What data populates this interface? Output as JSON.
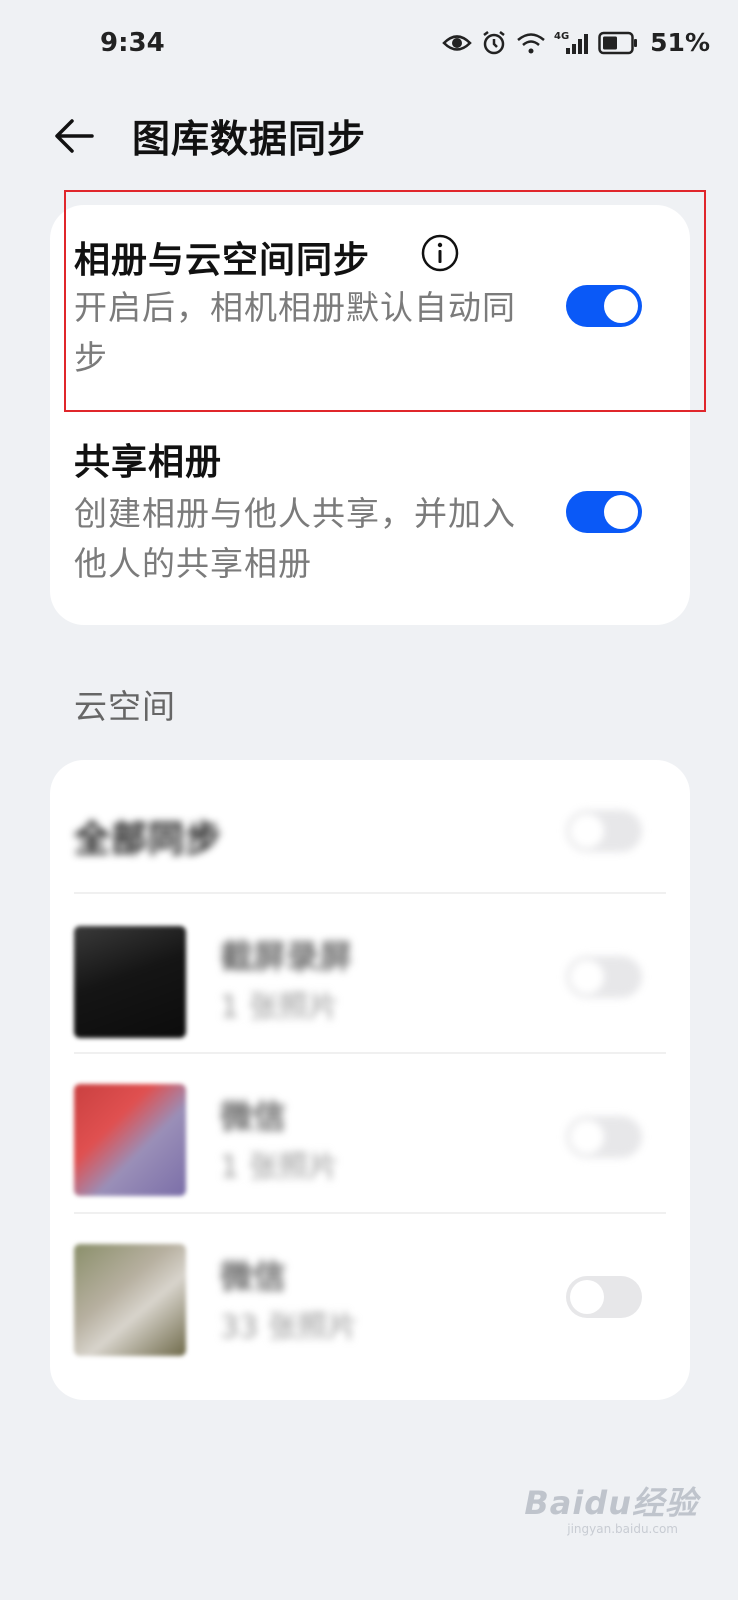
{
  "status_bar": {
    "time": "9:34",
    "battery": "51%",
    "network": "4G"
  },
  "header": {
    "title": "图库数据同步"
  },
  "settings": [
    {
      "title": "相册与云空间同步",
      "description": "开启后，相机相册默认自动同步",
      "toggle_on": true
    },
    {
      "title": "共享相册",
      "description": "创建相册与他人共享，并加入他人的共享相册",
      "toggle_on": true
    }
  ],
  "cloud_section": {
    "label": "云空间",
    "sync_all_label": "全部同步",
    "sync_all_on": false,
    "albums": [
      {
        "name": "截屏录屏",
        "count": "1 张照片",
        "toggle_on": false
      },
      {
        "name": "微信",
        "count": "1 张照片",
        "toggle_on": false
      },
      {
        "name": "微信",
        "count": "33 张照片",
        "toggle_on": false
      }
    ]
  },
  "watermark": {
    "text": "Baidu经验",
    "sub": "jingyan.baidu.com"
  },
  "colors": {
    "accent": "#0a59f7",
    "background": "#eff1f4",
    "highlight": "#e0262b"
  }
}
